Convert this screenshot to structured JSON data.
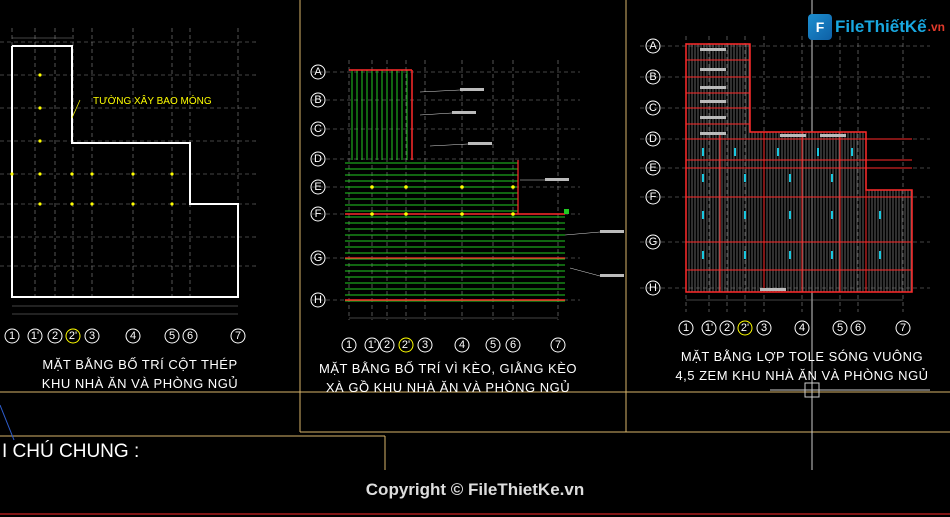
{
  "logo": {
    "text": "FileThiếtKế",
    "suffix": ".vn",
    "icon": "logo-mark-icon"
  },
  "panels": [
    {
      "id": "column-plan",
      "caption_line1": "MẶT BẰNG BỐ TRÍ CỘT THÉP",
      "caption_line2": "KHU NHÀ ĂN VÀ PHÒNG NGỦ",
      "wall_label": "TƯỜNG XÂY BAO MÓNG"
    },
    {
      "id": "truss-plan",
      "caption_line1": "MẶT BẰNG BỐ TRÍ VÌ KÈO, GIẰNG KÈO",
      "caption_line2": "XÀ GỒ KHU NHÀ ĂN VÀ PHÒNG NGỦ"
    },
    {
      "id": "roof-plan",
      "caption_line1": "MẶT BẰNG LỢP TOLE SÓNG VUÔNG",
      "caption_line2": "4,5 ZEM KHU NHÀ ĂN VÀ PHÒNG NGỦ"
    }
  ],
  "column_axes": [
    "1",
    "1'",
    "2",
    "2'",
    "3",
    "4",
    "5",
    "6",
    "7"
  ],
  "row_axes": [
    "A",
    "B",
    "C",
    "D",
    "E",
    "F",
    "G",
    "H"
  ],
  "notes_title": "I CHÚ CHUNG :",
  "copyright": "Copyright © FileThietKe.vn",
  "colors": {
    "grid": "#8a8a8a",
    "wall": "#ffffff",
    "purlin": "#22cc22",
    "red": "#ff2a2a",
    "yellow": "#ffff00",
    "cyan": "#19c8e0",
    "frame": "#d8b46a"
  }
}
